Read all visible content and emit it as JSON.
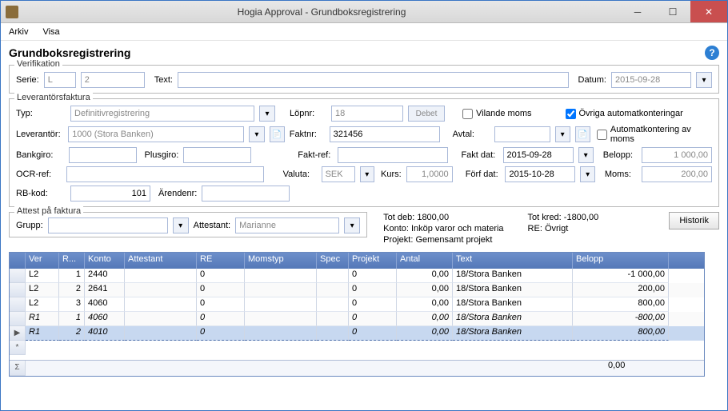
{
  "window": {
    "title": "Hogia Approval - Grundboksregistrering"
  },
  "menu": {
    "arkiv": "Arkiv",
    "visa": "Visa"
  },
  "page": {
    "title": "Grundboksregistrering"
  },
  "verifikation": {
    "legend": "Verifikation",
    "serie_lbl": "Serie:",
    "serie_val": "L",
    "nr_val": "2",
    "text_lbl": "Text:",
    "text_val": "",
    "datum_lbl": "Datum:",
    "datum_val": "2015-09-28"
  },
  "lev": {
    "legend": "Leverantörsfaktura",
    "typ_lbl": "Typ:",
    "typ_val": "Definitivregistrering",
    "lopnr_lbl": "Löpnr:",
    "lopnr_val": "18",
    "debet_btn": "Debet",
    "vilande_lbl": "Vilande moms",
    "ovriga_lbl": "Övriga automatkonteringar",
    "auto_moms_lbl": "Automatkontering av moms",
    "leverantor_lbl": "Leverantör:",
    "leverantor_val": "1000 (Stora Banken)",
    "faktnr_lbl": "Faktnr:",
    "faktnr_val": "321456",
    "avtal_lbl": "Avtal:",
    "avtal_val": "",
    "bankgiro_lbl": "Bankgiro:",
    "bankgiro_val": "",
    "plusgiro_lbl": "Plusgiro:",
    "plusgiro_val": "",
    "faktref_lbl": "Fakt-ref:",
    "faktref_val": "",
    "faktdat_lbl": "Fakt dat:",
    "faktdat_val": "2015-09-28",
    "belopp_lbl": "Belopp:",
    "belopp_val": "1 000,00",
    "ocr_lbl": "OCR-ref:",
    "ocr_val": "",
    "valuta_lbl": "Valuta:",
    "valuta_val": "SEK",
    "kurs_lbl": "Kurs:",
    "kurs_val": "1,0000",
    "forfdat_lbl": "Förf dat:",
    "forfdat_val": "2015-10-28",
    "moms_lbl": "Moms:",
    "moms_val": "200,00",
    "rbkod_lbl": "RB-kod:",
    "rbkod_val": "101",
    "arendenr_lbl": "Ärendenr:",
    "arendenr_val": ""
  },
  "attest": {
    "legend": "Attest på faktura",
    "grupp_lbl": "Grupp:",
    "grupp_val": "",
    "attestant_lbl": "Attestant:",
    "attestant_val": "Marianne"
  },
  "summary": {
    "totdeb": "Tot deb: 1800,00",
    "konto": "Konto: Inköp varor och materia",
    "projekt": "Projekt: Gemensamt projekt",
    "totkred": "Tot kred: -1800,00",
    "re": "RE: Övrigt",
    "historik_btn": "Historik"
  },
  "grid": {
    "headers": {
      "ver": "Ver",
      "r": "R...",
      "konto": "Konto",
      "attestant": "Attestant",
      "re": "RE",
      "momstyp": "Momstyp",
      "spec": "Spec",
      "projekt": "Projekt",
      "antal": "Antal",
      "text": "Text",
      "belopp": "Belopp"
    },
    "rows": [
      {
        "ver": "L2",
        "r": "1",
        "konto": "2440",
        "att": "",
        "re": "0",
        "moms": "",
        "spec": "",
        "proj": "0",
        "antal": "0,00",
        "text": "18/Stora Banken",
        "belopp": "-1 000,00",
        "italic": false,
        "sel": false
      },
      {
        "ver": "L2",
        "r": "2",
        "konto": "2641",
        "att": "",
        "re": "0",
        "moms": "",
        "spec": "",
        "proj": "0",
        "antal": "0,00",
        "text": "18/Stora Banken",
        "belopp": "200,00",
        "italic": false,
        "sel": false
      },
      {
        "ver": "L2",
        "r": "3",
        "konto": "4060",
        "att": "",
        "re": "0",
        "moms": "",
        "spec": "",
        "proj": "0",
        "antal": "0,00",
        "text": "18/Stora Banken",
        "belopp": "800,00",
        "italic": false,
        "sel": false
      },
      {
        "ver": "R1",
        "r": "1",
        "konto": "4060",
        "att": "",
        "re": "0",
        "moms": "",
        "spec": "",
        "proj": "0",
        "antal": "0,00",
        "text": "18/Stora Banken",
        "belopp": "-800,00",
        "italic": true,
        "sel": false
      },
      {
        "ver": "R1",
        "r": "2",
        "konto": "4010",
        "att": "",
        "re": "0",
        "moms": "",
        "spec": "",
        "proj": "0",
        "antal": "0,00",
        "text": "18/Stora Banken",
        "belopp": "800,00",
        "italic": true,
        "sel": true
      }
    ],
    "sum_belopp": "0,00"
  }
}
